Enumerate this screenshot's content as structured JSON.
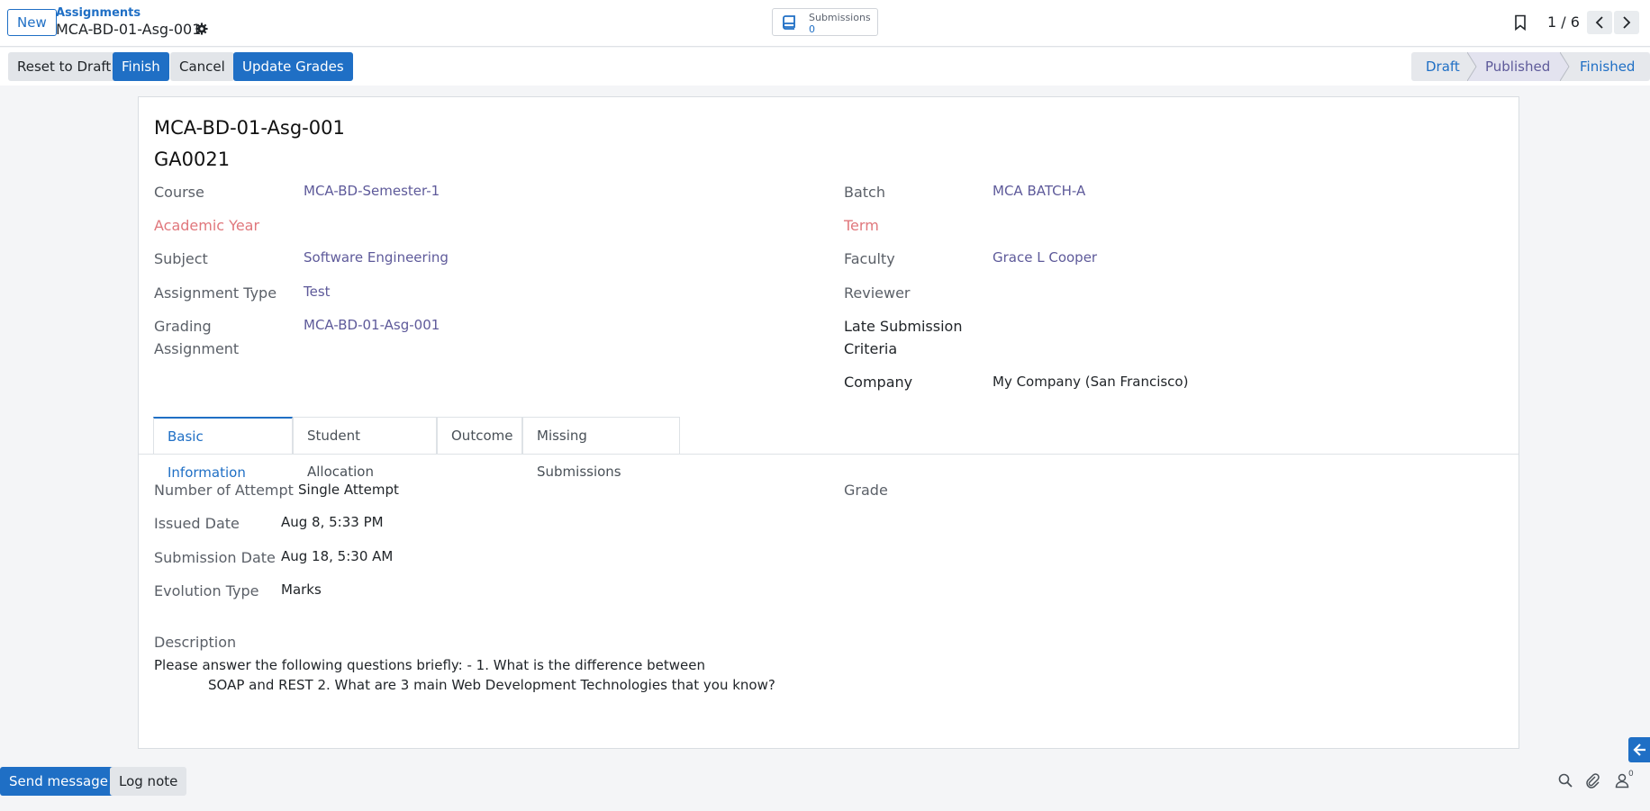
{
  "control_panel": {
    "new_label": "New",
    "breadcrumb_parent": "Assignments",
    "breadcrumb_current": "MCA-BD-01-Asg-001",
    "submissions_label": "Submissions",
    "submissions_count": "0",
    "pager_value": "1 / 6"
  },
  "actions": {
    "reset_to_draft": "Reset to Draft",
    "finish": "Finish",
    "cancel": "Cancel",
    "update_grades": "Update Grades"
  },
  "stages": {
    "draft": "Draft",
    "published": "Published",
    "finished": "Finished",
    "current": "Published"
  },
  "record": {
    "name": "MCA-BD-01-Asg-001",
    "code": "GA0021",
    "left_fields": {
      "course_label": "Course",
      "course_value": "MCA-BD-Semester-1",
      "academic_year_label": "Academic Year",
      "subject_label": "Subject",
      "subject_value": "Software Engineering",
      "assignment_type_label": "Assignment Type",
      "assignment_type_value": "Test",
      "grading_label_line1": "Grading",
      "grading_label_line2": "Assignment",
      "grading_value": "MCA-BD-01-Asg-001"
    },
    "right_fields": {
      "batch_label": "Batch",
      "batch_value": "MCA BATCH-A",
      "term_label": "Term",
      "faculty_label": "Faculty",
      "faculty_value": "Grace L Cooper",
      "reviewer_label": "Reviewer",
      "late_label_line1": "Late Submission",
      "late_label_line2": "Criteria",
      "company_label": "Company",
      "company_value": "My Company (San Francisco)"
    }
  },
  "tabs": [
    "Basic Information",
    "Student Allocation",
    "Outcome",
    "Missing Submissions"
  ],
  "basic_info": {
    "attempt_label": "Number of Attempt",
    "attempt_value": "Single Attempt",
    "issued_label": "Issued Date",
    "issued_value": "Aug 8, 5:33 PM",
    "submission_label": "Submission Date",
    "submission_value": "Aug 18, 5:30 AM",
    "evolution_label": "Evolution Type",
    "evolution_value": "Marks",
    "grade_label": "Grade",
    "description_label": "Description",
    "description_line1": "Please answer the following questions briefly: - 1. What is the difference between",
    "description_line2": "SOAP and REST 2. What are 3 main Web Development Technologies that you know?"
  },
  "chatter": {
    "send_message": "Send message",
    "log_note": "Log note",
    "follower_count": "0"
  },
  "colors": {
    "primary": "#1f6fc5",
    "link": "#5e5a9a",
    "required_label": "#e0777c"
  }
}
